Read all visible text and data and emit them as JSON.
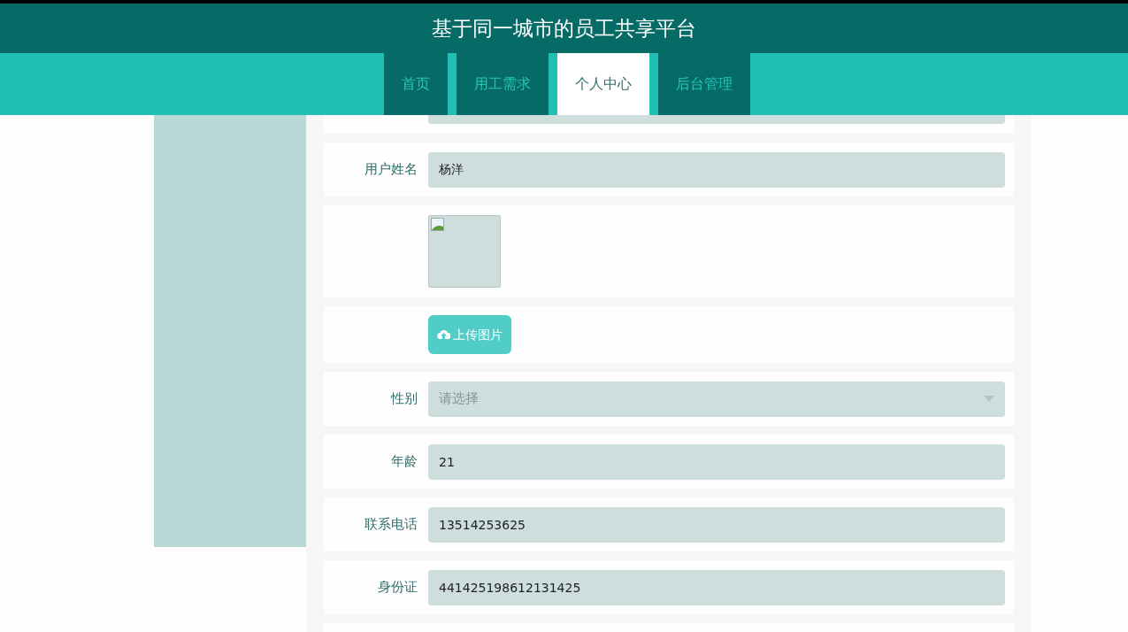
{
  "header": {
    "title": "基于同一城市的员工共享平台"
  },
  "tabs": [
    {
      "label": "首页",
      "selected": false
    },
    {
      "label": "用工需求",
      "selected": false
    },
    {
      "label": "个人中心",
      "selected": true
    },
    {
      "label": "后台管理",
      "selected": false
    }
  ],
  "form": [
    {
      "kind": "text",
      "label": "用户姓名",
      "value": "杨洋"
    },
    {
      "kind": "image"
    },
    {
      "kind": "upload",
      "button": "上传图片"
    },
    {
      "kind": "select",
      "label": "性别",
      "placeholder": "请选择"
    },
    {
      "kind": "text",
      "label": "年龄",
      "value": "21"
    },
    {
      "kind": "text",
      "label": "联系电话",
      "value": "13514253625"
    },
    {
      "kind": "text",
      "label": "身份证",
      "value": "441425198612131425"
    }
  ]
}
